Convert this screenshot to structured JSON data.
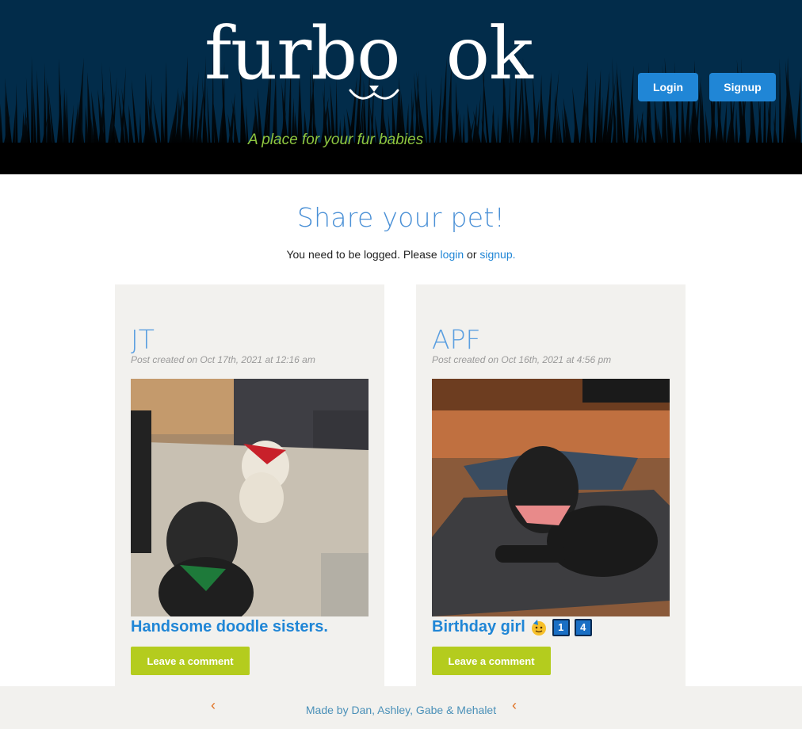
{
  "header": {
    "logo_left": "furbo",
    "logo_right": "ok",
    "tagline": "A place for your fur babies",
    "login_label": "Login",
    "signup_label": "Signup"
  },
  "main": {
    "title": "Share your pet!",
    "note_prefix": "You need to be logged. Please ",
    "note_login": "login",
    "note_or": " or ",
    "note_signup": "signup."
  },
  "posts": [
    {
      "author": "JT",
      "meta": "Post created on Oct 17th, 2021 at 12:16 am",
      "caption": "Handsome doodle sisters.",
      "comment_label": "Leave a comment"
    },
    {
      "author": "APF",
      "meta": "Post created on Oct 16th, 2021 at 4:56 pm",
      "caption": "Birthday girl",
      "badges": [
        "1",
        "4"
      ],
      "comment_label": "Leave a comment"
    }
  ],
  "footer": {
    "credit": "Made by Dan, Ashley, Gabe & Mehalet",
    "arrow": "‹"
  },
  "colors": {
    "header_bg": "#022c4a",
    "accent": "#2086d6",
    "tagline": "#8ec63f",
    "comment_button": "#b4cc1e",
    "card_bg": "#f2f1ee"
  }
}
